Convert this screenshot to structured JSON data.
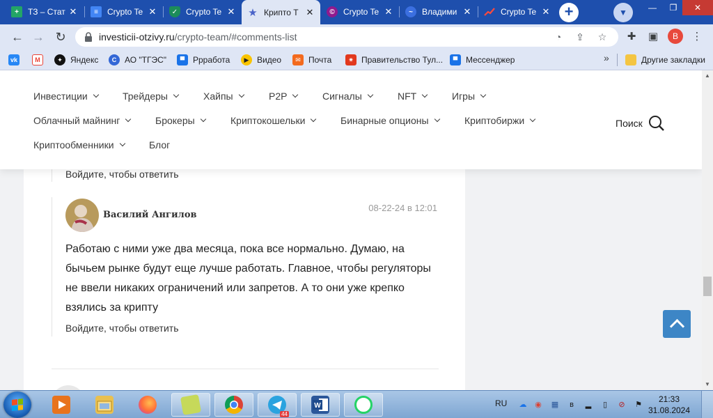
{
  "browser": {
    "tabs": [
      {
        "label": "ТЗ – Стат",
        "icon": "sheets-icon",
        "color": "#23a566"
      },
      {
        "label": "Crypto Te",
        "icon": "docs-icon",
        "color": "#4285f4"
      },
      {
        "label": "Crypto Te",
        "icon": "shield-icon",
        "color": "#1c8c5a"
      },
      {
        "label": "Крипто Т",
        "icon": "star-icon",
        "color": "#f4c20d"
      },
      {
        "label": "Crypto Te",
        "icon": "circle-logo-icon",
        "color": "#8e1a8e"
      },
      {
        "label": "Владими",
        "icon": "chart-icon",
        "color": "#3b6fe0"
      },
      {
        "label": "Crypto Te",
        "icon": "trend-icon",
        "color": "#d93025"
      }
    ],
    "address": {
      "domain": "investicii-otzivy.ru",
      "path": "/crypto-team/#comments-list"
    },
    "profile_initial": "B",
    "bookmarks": [
      {
        "label": "",
        "icon": "vk-icon",
        "color": "#2787f5"
      },
      {
        "label": "",
        "icon": "gmail-icon",
        "color": "#ea4335"
      },
      {
        "label": "Яндекс",
        "icon": "yandex-icon",
        "color": "#111111"
      },
      {
        "label": "АО \"ТГЭС\"",
        "icon": "tges-icon",
        "color": "#3367d6"
      },
      {
        "label": "Ррработа",
        "icon": "chat-bubble-icon",
        "color": "#1a73e8"
      },
      {
        "label": "Видео",
        "icon": "play-icon",
        "color": "#f9c400"
      },
      {
        "label": "Почта",
        "icon": "mail-icon",
        "color": "#f36a1e"
      },
      {
        "label": "Правительство Тул...",
        "icon": "emblem-icon",
        "color": "#e2381d"
      },
      {
        "label": "Мессенджер",
        "icon": "chat-bubble-icon",
        "color": "#1a73e8"
      }
    ],
    "other_bookmarks": "Другие закладки"
  },
  "site": {
    "menu_row1": [
      "Инвестиции",
      "Трейдеры",
      "Хайпы",
      "P2P",
      "Сигналы",
      "NFT",
      "Игры"
    ],
    "menu_row2": [
      "Облачный майнинг",
      "Брокеры",
      "Криптокошельки",
      "Бинарные опционы",
      "Криптобиржи"
    ],
    "menu_row3": [
      "Криптообменники",
      "Блог"
    ],
    "search_label": "Поиск"
  },
  "comments": {
    "reply_login": "Войдите, чтобы ответить",
    "author": "Василий Ангилов",
    "date": "08-22-24 в 12:01",
    "text": "Работаю с ними уже два месяца, пока все нормально. Думаю, на бычьем рынке будут еще лучше работать. Главное, чтобы регуляторы не ввели никаких ограничений или запретов. А то они уже крепко взялись за крипту"
  },
  "taskbar": {
    "apps": [
      {
        "icon": "media-player-icon",
        "color": "#e8731d"
      },
      {
        "icon": "file-explorer-icon",
        "color": "#e9c050"
      },
      {
        "icon": "firefox-icon",
        "color": "#ff7139"
      },
      {
        "icon": "sticky-notes-icon",
        "color": "#c6d95a"
      },
      {
        "icon": "chrome-icon",
        "color": "#4285f4"
      },
      {
        "icon": "telegram-icon",
        "color": "#2aa3df",
        "badge": "44"
      },
      {
        "icon": "word-icon",
        "color": "#2b579a"
      },
      {
        "icon": "whatsapp-icon",
        "color": "#25d366"
      }
    ],
    "language": "RU",
    "time": "21:33",
    "date": "31.08.2024"
  }
}
